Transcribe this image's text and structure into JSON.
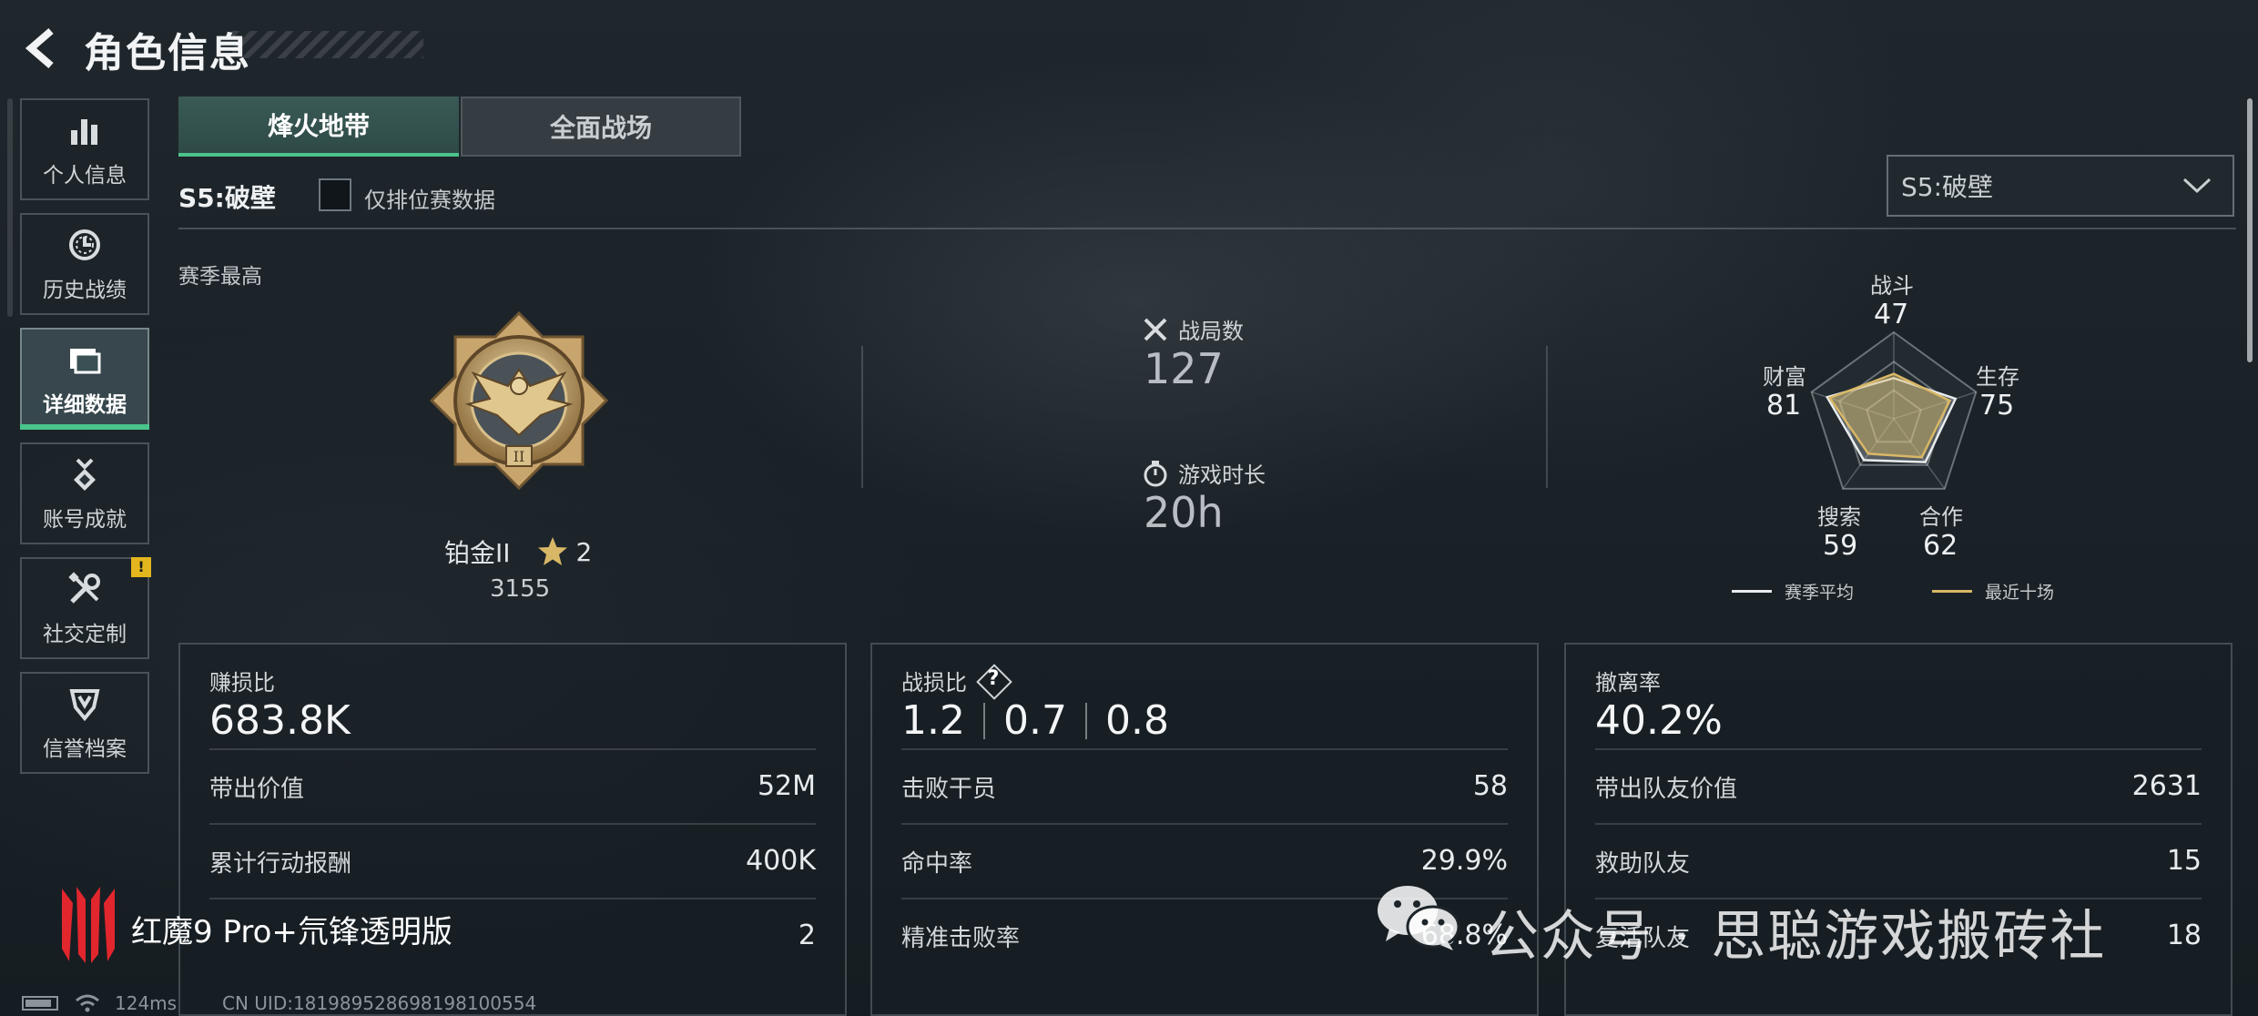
{
  "header": {
    "title": "角色信息"
  },
  "sidebar": {
    "items": [
      {
        "label": "个人信息",
        "icon": "bar-chart-icon",
        "active": false
      },
      {
        "label": "历史战绩",
        "icon": "history-clock-icon",
        "active": false
      },
      {
        "label": "详细数据",
        "icon": "cards-icon",
        "active": true
      },
      {
        "label": "账号成就",
        "icon": "medal-icon",
        "active": false
      },
      {
        "label": "社交定制",
        "icon": "tools-icon",
        "active": false,
        "badge": "!"
      },
      {
        "label": "信誉档案",
        "icon": "shield-icon",
        "active": false
      }
    ]
  },
  "tabs": [
    {
      "label": "烽火地带",
      "active": true
    },
    {
      "label": "全面战场",
      "active": false
    }
  ],
  "season": {
    "label": "S5:破壁",
    "ranked_only_label": "仅排位赛数据",
    "ranked_only_checked": false,
    "select_value": "S5:破壁"
  },
  "season_best": {
    "label": "赛季最高",
    "rank_name": "铂金II",
    "stars": "2",
    "score": "3155"
  },
  "summary": {
    "matches_label": "战局数",
    "matches_value": "127",
    "playtime_label": "游戏时长",
    "playtime_value": "20h"
  },
  "radar": {
    "axes": [
      {
        "label": "战斗",
        "value": "47"
      },
      {
        "label": "生存",
        "value": "75"
      },
      {
        "label": "合作",
        "value": "62"
      },
      {
        "label": "搜索",
        "value": "59"
      },
      {
        "label": "财富",
        "value": "81"
      }
    ],
    "recent": [
      52,
      68,
      55,
      50,
      78
    ],
    "legend": [
      {
        "label": "赛季平均",
        "color": "#e8ecee"
      },
      {
        "label": "最近十场",
        "color": "#d8b766"
      }
    ]
  },
  "panels": {
    "profit": {
      "title": "赚损比",
      "value": "683.8K",
      "rows": [
        {
          "label": "带出价值",
          "value": "52M"
        },
        {
          "label": "累计行动报酬",
          "value": "400K"
        },
        {
          "label": "",
          "value": "2"
        }
      ]
    },
    "combat": {
      "title": "战损比",
      "help": "?",
      "values": [
        "1.2",
        "0.7",
        "0.8"
      ],
      "rows": [
        {
          "label": "击败干员",
          "value": "58"
        },
        {
          "label": "命中率",
          "value": "29.9%"
        },
        {
          "label": "精准击败率",
          "value": "68.8%"
        }
      ]
    },
    "extract": {
      "title": "撤离率",
      "value": "40.2%",
      "rows": [
        {
          "label": "带出队友价值",
          "value": "2631"
        },
        {
          "label": "救助队友",
          "value": "15"
        },
        {
          "label": "复活队友",
          "value": "18"
        }
      ]
    }
  },
  "watermark": {
    "brand": "红魔9 Pro+氘锋透明版",
    "wechat": "公众号 · 思聪游戏搬砖社"
  },
  "status": {
    "ping": "124ms",
    "uid": "CN UID:181989528698198100554"
  },
  "colors": {
    "accent": "#4cc38a",
    "gold": "#d8b766",
    "badge": "#e3b61d"
  }
}
